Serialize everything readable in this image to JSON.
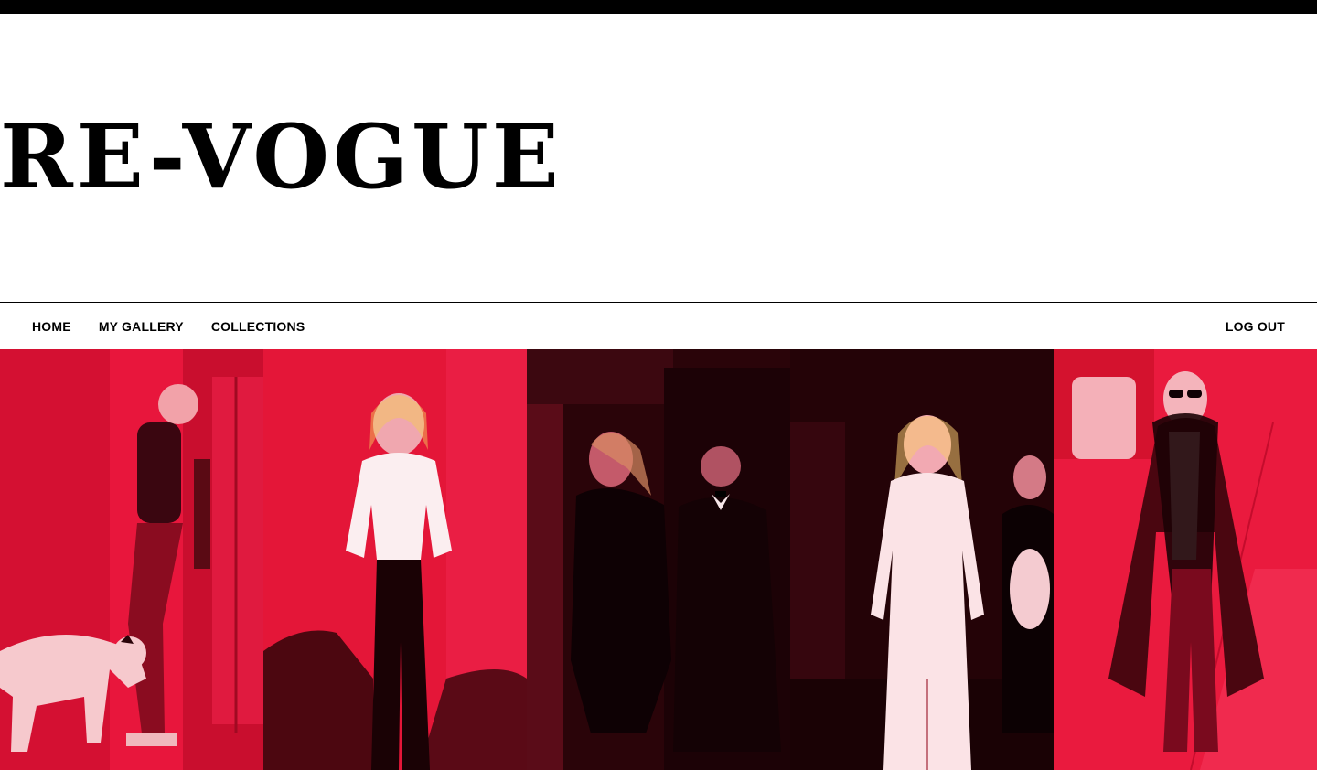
{
  "brand": {
    "logo_text": "RE-VOGUE"
  },
  "nav": {
    "items": [
      {
        "label": "HOME"
      },
      {
        "label": "MY GALLERY"
      },
      {
        "label": "COLLECTIONS"
      }
    ],
    "logout_label": "LOG OUT"
  },
  "gallery": {
    "tint_color": "#e8113a",
    "tiles": [
      {
        "theme": "red"
      },
      {
        "theme": "red"
      },
      {
        "theme": "dark"
      },
      {
        "theme": "dark"
      },
      {
        "theme": "red"
      }
    ]
  }
}
